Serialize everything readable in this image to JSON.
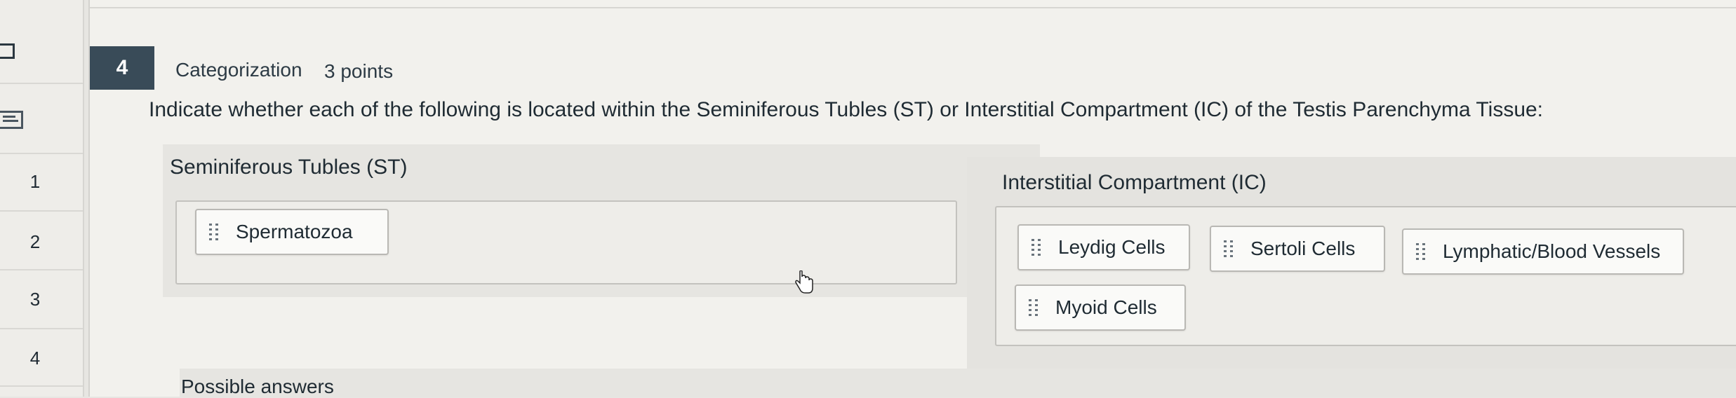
{
  "nav": {
    "items": [
      "1",
      "2",
      "3",
      "4"
    ]
  },
  "question": {
    "number": "4",
    "type": "Categorization",
    "points": "3 points",
    "prompt": "Indicate whether each of the following is located within the Seminiferous Tubles (ST) or Interstitial Compartment (IC) of the Testis Parenchyma Tissue:"
  },
  "categories": {
    "st": {
      "title": "Seminiferous Tubles (ST)",
      "items": [
        "Spermatozoa"
      ]
    },
    "ic": {
      "title": "Interstitial Compartment (IC)",
      "items": [
        "Leydig Cells",
        "Sertoli Cells",
        "Lymphatic/Blood Vessels",
        "Myoid Cells"
      ]
    }
  },
  "possible_answers": {
    "label": "Possible answers"
  },
  "icons": {
    "drag": "drag-handle-icon",
    "cursor": "hand-cursor-icon"
  }
}
